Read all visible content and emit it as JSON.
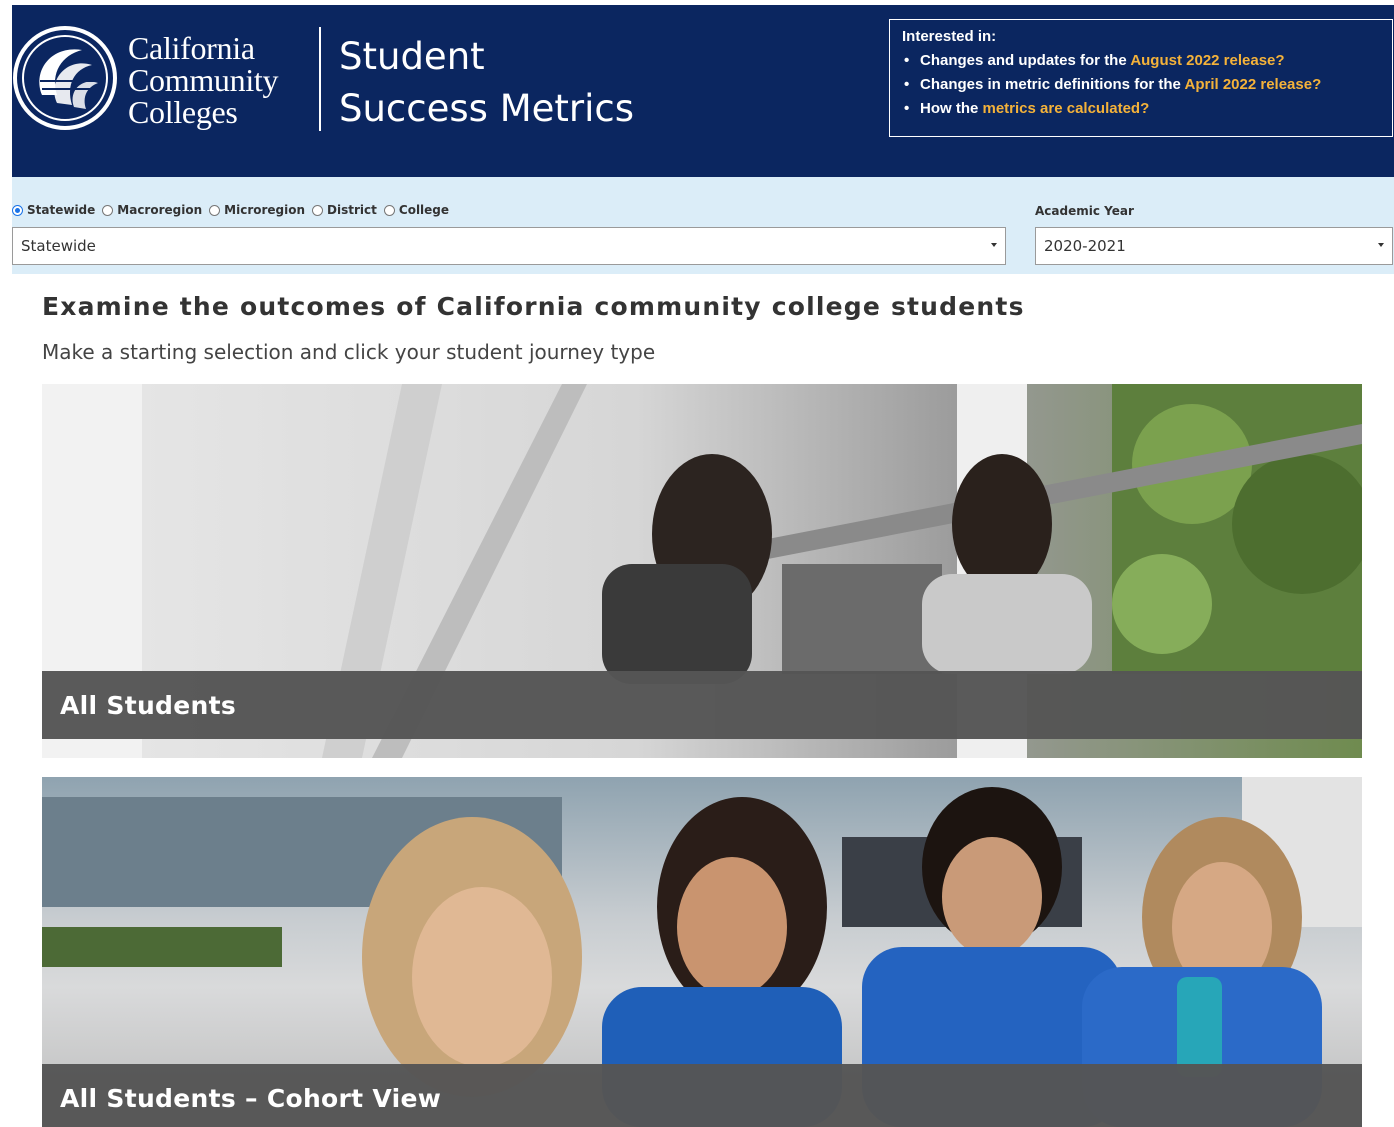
{
  "header": {
    "brand_lines": [
      "California",
      "Community",
      "Colleges"
    ],
    "title_lines": [
      "Student",
      "Success Metrics"
    ],
    "info": {
      "intro": "Interested in:",
      "items": [
        {
          "text": "Changes and updates for the ",
          "link": "August 2022 release?"
        },
        {
          "text": "Changes in metric definitions for the ",
          "link": "April 2022 release?"
        },
        {
          "text": "How the ",
          "link": "metrics are calculated?"
        }
      ]
    }
  },
  "filters": {
    "levels": [
      {
        "label": "Statewide",
        "checked": true
      },
      {
        "label": "Macroregion",
        "checked": false
      },
      {
        "label": "Microregion",
        "checked": false
      },
      {
        "label": "District",
        "checked": false
      },
      {
        "label": "College",
        "checked": false
      }
    ],
    "region_select": {
      "value": "Statewide"
    },
    "year_label": "Academic Year",
    "year_select": {
      "value": "2020-2021"
    }
  },
  "main": {
    "headline": "Examine the outcomes of California community college students",
    "subhead": "Make a starting selection and click your student journey type",
    "cards": [
      {
        "label": "All Students"
      },
      {
        "label": "All Students – Cohort View"
      }
    ]
  },
  "colors": {
    "header_bg": "#0b2660",
    "accent_link": "#f4b23a",
    "filter_bg": "#dbedf8",
    "banner_bg": "#555555"
  }
}
